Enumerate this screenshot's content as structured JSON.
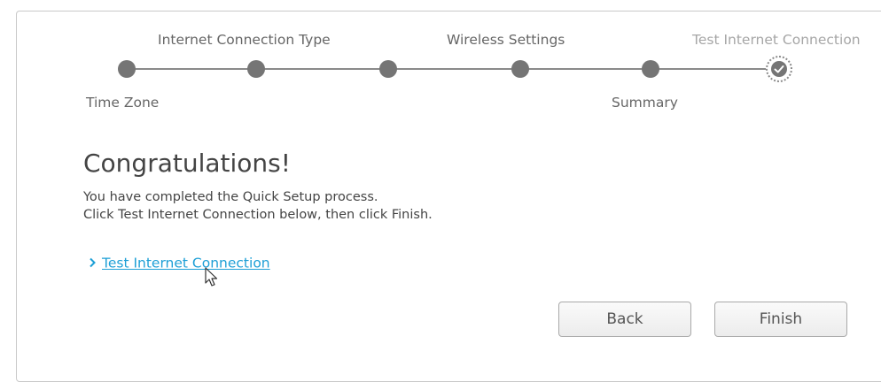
{
  "stepper": {
    "top_labels": {
      "internet_connection_type": "Internet Connection Type",
      "wireless_settings": "Wireless Settings",
      "test_internet_connection": "Test Internet Connection"
    },
    "bottom_labels": {
      "time_zone": "Time Zone",
      "summary": "Summary"
    },
    "current_step": "test_internet_connection",
    "line_color": "#8a8a8a",
    "dot_color": "#757575"
  },
  "main": {
    "heading": "Congratulations!",
    "line1": "You have completed the Quick Setup process.",
    "line2": "Click Test Internet Connection below, then click Finish.",
    "test_link": "Test Internet Connection",
    "link_color": "#1d9fd6"
  },
  "buttons": {
    "back": "Back",
    "finish": "Finish"
  }
}
